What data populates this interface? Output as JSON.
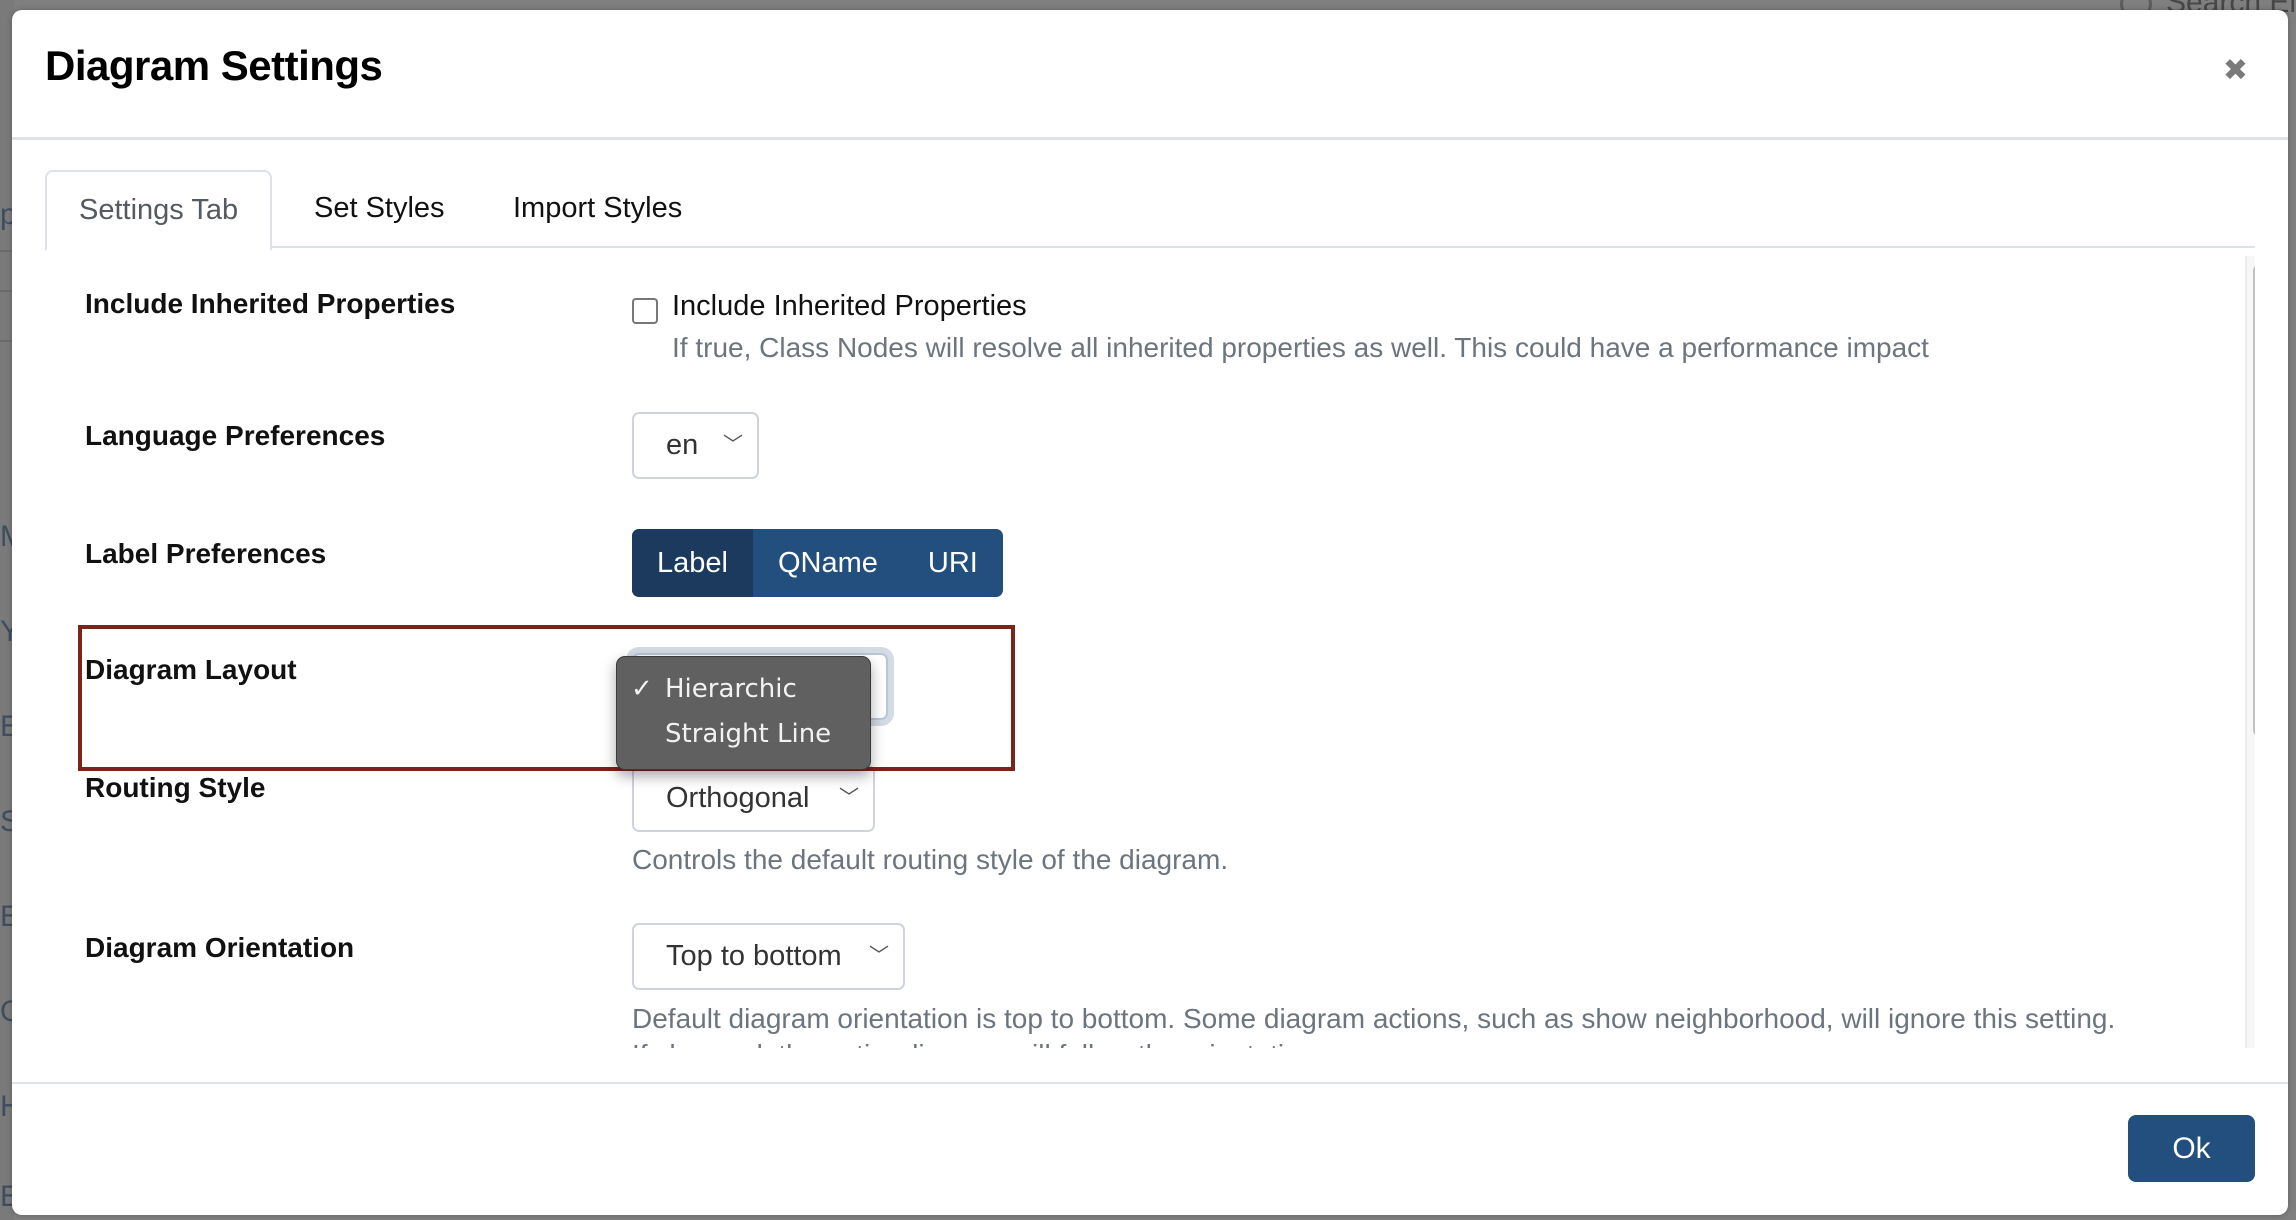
{
  "background": {
    "left_letters": [
      "p",
      "M",
      "Y",
      "E",
      "S",
      "E",
      "O",
      "H",
      "E"
    ],
    "search_placeholder": "Search El"
  },
  "dialog": {
    "title": "Diagram Settings",
    "close_icon": "close-icon",
    "tabs": [
      {
        "label": "Settings Tab",
        "active": true
      },
      {
        "label": "Set Styles",
        "active": false
      },
      {
        "label": "Import Styles",
        "active": false
      }
    ],
    "settings": {
      "include_inherited": {
        "label": "Include Inherited Properties",
        "checkbox_label": "Include Inherited Properties",
        "checked": false,
        "description": "If true, Class Nodes will resolve all inherited properties as well. This could have a performance impact"
      },
      "language": {
        "label": "Language Preferences",
        "value": "en"
      },
      "label_preferences": {
        "label": "Label Preferences",
        "options": [
          "Label",
          "QName",
          "URI"
        ],
        "selected": "Label"
      },
      "diagram_layout": {
        "label": "Diagram Layout",
        "value": "Hierarchic",
        "dropdown_open": true,
        "options": [
          {
            "label": "Hierarchic",
            "checked": true
          },
          {
            "label": "Straight Line",
            "checked": false
          }
        ],
        "check_glyph": "✓"
      },
      "routing_style": {
        "label": "Routing Style",
        "value": "Orthogonal",
        "description": "Controls the default routing style of the diagram."
      },
      "diagram_orientation": {
        "label": "Diagram Orientation",
        "value": "Top to bottom",
        "description": "Default diagram orientation is top to bottom. Some diagram actions, such as show neighborhood, will ignore this setting.",
        "description_cut": "If changed, the entire diagram will follow the orientation"
      }
    },
    "footer": {
      "ok_label": "Ok"
    },
    "colors": {
      "primary": "#234f7e",
      "primary_active": "#1b3a5e",
      "highlight_border": "#7a2517",
      "dropdown_bg": "#606060"
    }
  }
}
